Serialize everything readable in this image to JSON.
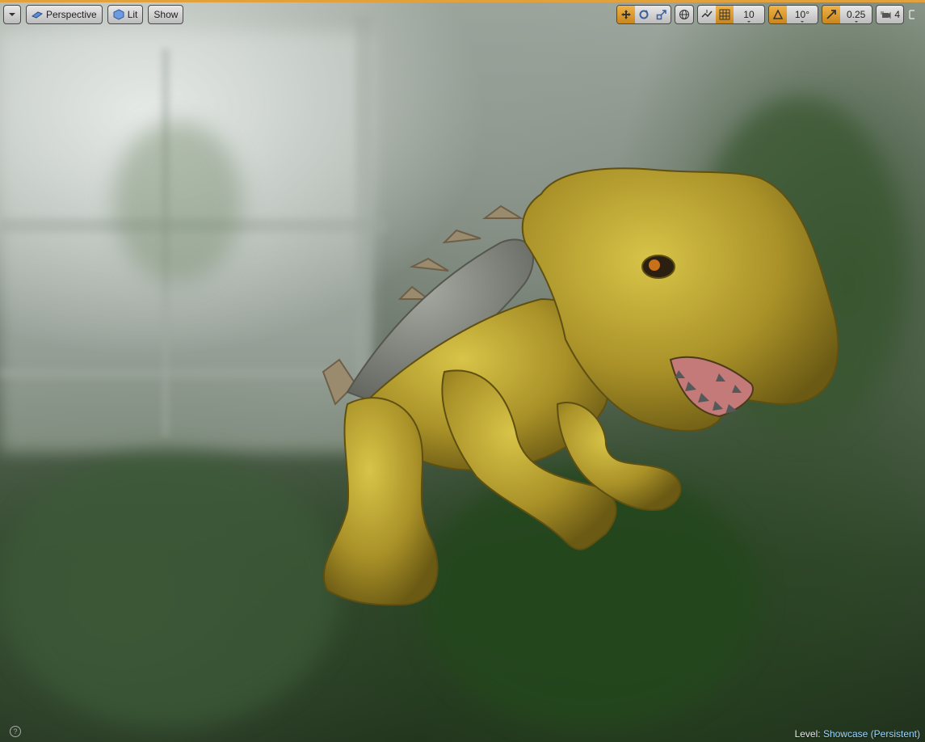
{
  "toolbar_left": {
    "menu_icon": "chevron-down-icon",
    "perspective_label": "Perspective",
    "perspective_icon": "perspective-icon",
    "lit_label": "Lit",
    "lit_icon": "lit-cube-icon",
    "show_label": "Show"
  },
  "toolbar_right": {
    "transform_icons": [
      "translate-icon",
      "rotate-icon",
      "scale-icon"
    ],
    "world_icon": "globe-icon",
    "surface_snap_icon": "surface-snap-icon",
    "grid_snap_icon": "grid-icon",
    "grid_snap_value": "10",
    "rotation_snap_icon": "angle-icon",
    "rotation_snap_value": "10°",
    "scale_snap_icon": "scale-snap-icon",
    "scale_snap_value": "0.25",
    "camera_speed_icon": "camera-speed-icon",
    "camera_speed_value": "4",
    "maximize_icon": "maximize-icon"
  },
  "status": {
    "level_prefix": "Level:",
    "level_name": "Showcase (Persistent)"
  },
  "colors": {
    "accent": "#e2a13a",
    "creature_body": "#b8a232",
    "creature_shell": "#8a8c86"
  }
}
